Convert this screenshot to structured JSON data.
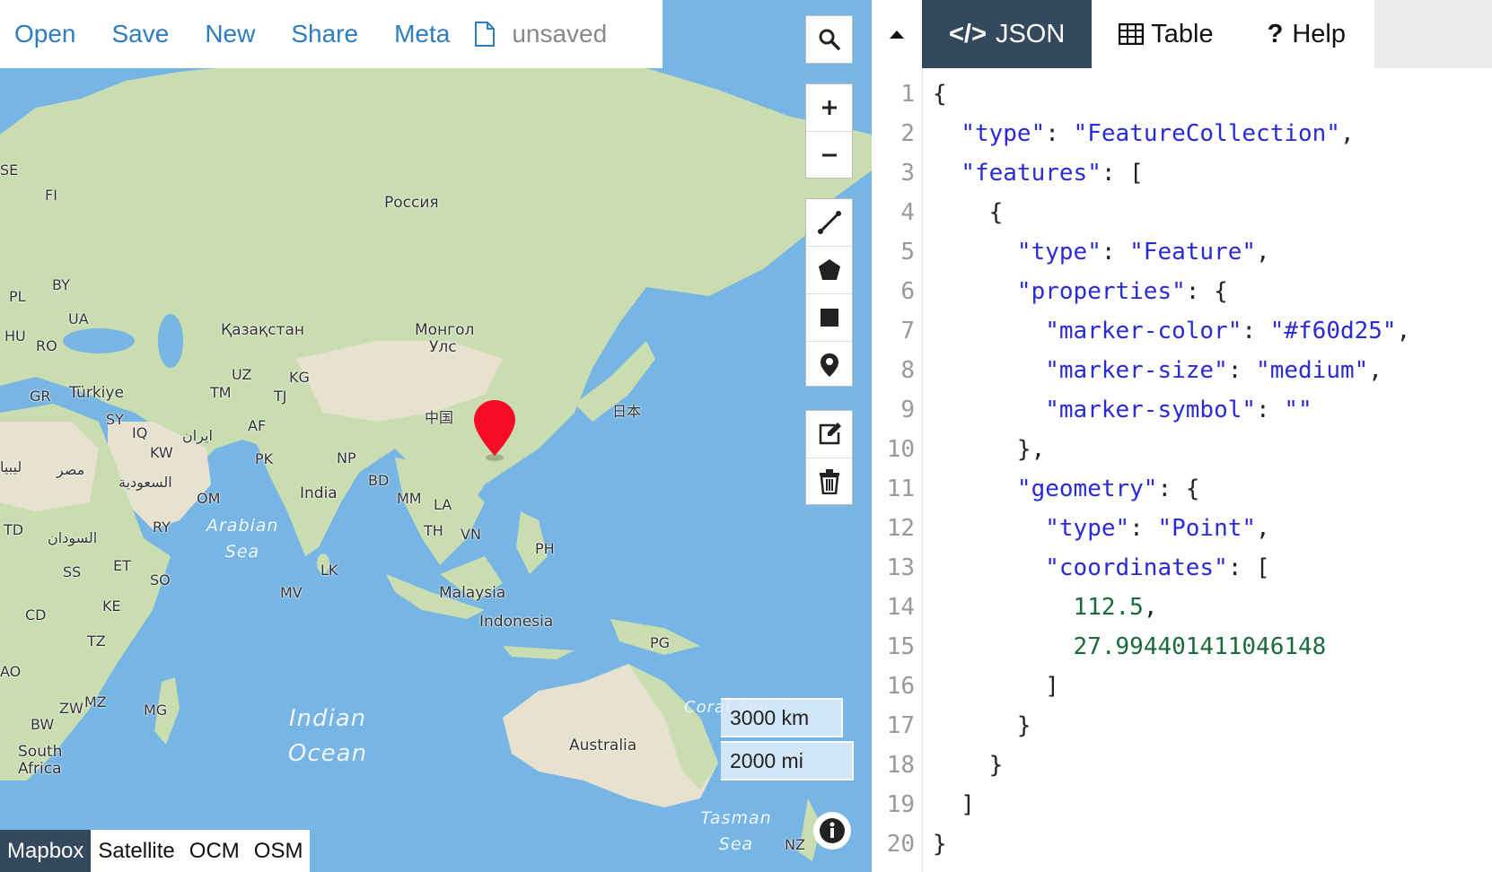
{
  "menu": {
    "open": "Open",
    "save": "Save",
    "new": "New",
    "share": "Share",
    "meta": "Meta",
    "filename": "unsaved",
    "file_icon": "file-icon"
  },
  "map_labels": {
    "se": "SE",
    "fi": "FI",
    "russia": "Россия",
    "by": "BY",
    "pl": "PL",
    "ua": "UA",
    "hu": "HU",
    "ro": "RO",
    "kazakhstan": "Қазақстан",
    "mongolia_1": "Монгол",
    "mongolia_2": "Улс",
    "gr": "GR",
    "turkiye": "Türkiye",
    "uz": "UZ",
    "kg": "KG",
    "tm": "TM",
    "tj": "TJ",
    "sy": "SY",
    "iq": "IQ",
    "iran": "ایران",
    "af": "AF",
    "china": "中国",
    "japan": "日本",
    "libya": "ليبيا",
    "egypt": "مصر",
    "kw": "KW",
    "pk": "PK",
    "np": "NP",
    "saudi": "السعودية",
    "om": "OM",
    "india": "India",
    "bd": "BD",
    "mm": "MM",
    "la": "LA",
    "td": "TD",
    "sudan": "السودان",
    "ry": "RY",
    "th": "TH",
    "vn": "VN",
    "ph": "PH",
    "ss": "SS",
    "et": "ET",
    "so": "SO",
    "lk": "LK",
    "mv": "MV",
    "malaysia": "Malaysia",
    "cd": "CD",
    "ke": "KE",
    "indonesia": "Indonesia",
    "tz": "TZ",
    "pg": "PG",
    "ao": "AO",
    "zw": "ZW",
    "mz": "MZ",
    "mg": "MG",
    "bw": "BW",
    "south_africa_1": "South",
    "south_africa_2": "Africa",
    "australia": "Australia",
    "nz": "NZ"
  },
  "seas": {
    "arabian_1": "Arabian",
    "arabian_2": "Sea",
    "indian_1": "Indian",
    "indian_2": "Ocean",
    "coral": "Coral Sea",
    "tasman_1": "Tasman",
    "tasman_2": "Sea"
  },
  "marker": {
    "color": "#f60d25"
  },
  "scale": {
    "km": "3000 km",
    "mi": "2000 mi"
  },
  "layers": {
    "items": [
      "Mapbox",
      "Satellite",
      "OCM",
      "OSM"
    ],
    "active": "Mapbox"
  },
  "controls": {
    "search": "search-icon",
    "zoom_in": "plus-icon",
    "zoom_out": "minus-icon",
    "line": "draw-line-icon",
    "polygon": "draw-polygon-icon",
    "rectangle": "draw-rectangle-icon",
    "marker": "draw-marker-icon",
    "edit": "edit-icon",
    "delete": "trash-icon",
    "info": "info-icon"
  },
  "tabs": {
    "json": "JSON",
    "table": "Table",
    "help": "Help"
  },
  "editor": {
    "line_numbers": [
      "1",
      "2",
      "3",
      "4",
      "5",
      "6",
      "7",
      "8",
      "9",
      "10",
      "11",
      "12",
      "13",
      "14",
      "15",
      "16",
      "17",
      "18",
      "19",
      "20"
    ],
    "keys": {
      "type": "\"type\"",
      "features": "\"features\"",
      "properties": "\"properties\"",
      "marker_color": "\"marker-color\"",
      "marker_size": "\"marker-size\"",
      "marker_symbol": "\"marker-symbol\"",
      "geometry": "\"geometry\"",
      "coordinates": "\"coordinates\""
    },
    "values": {
      "feature_collection": "\"FeatureCollection\"",
      "feature": "\"Feature\"",
      "color": "\"#f60d25\"",
      "size": "\"medium\"",
      "symbol": "\"\"",
      "point": "\"Point\"",
      "lon": "112.5",
      "lat": "27.994401411046148"
    }
  }
}
